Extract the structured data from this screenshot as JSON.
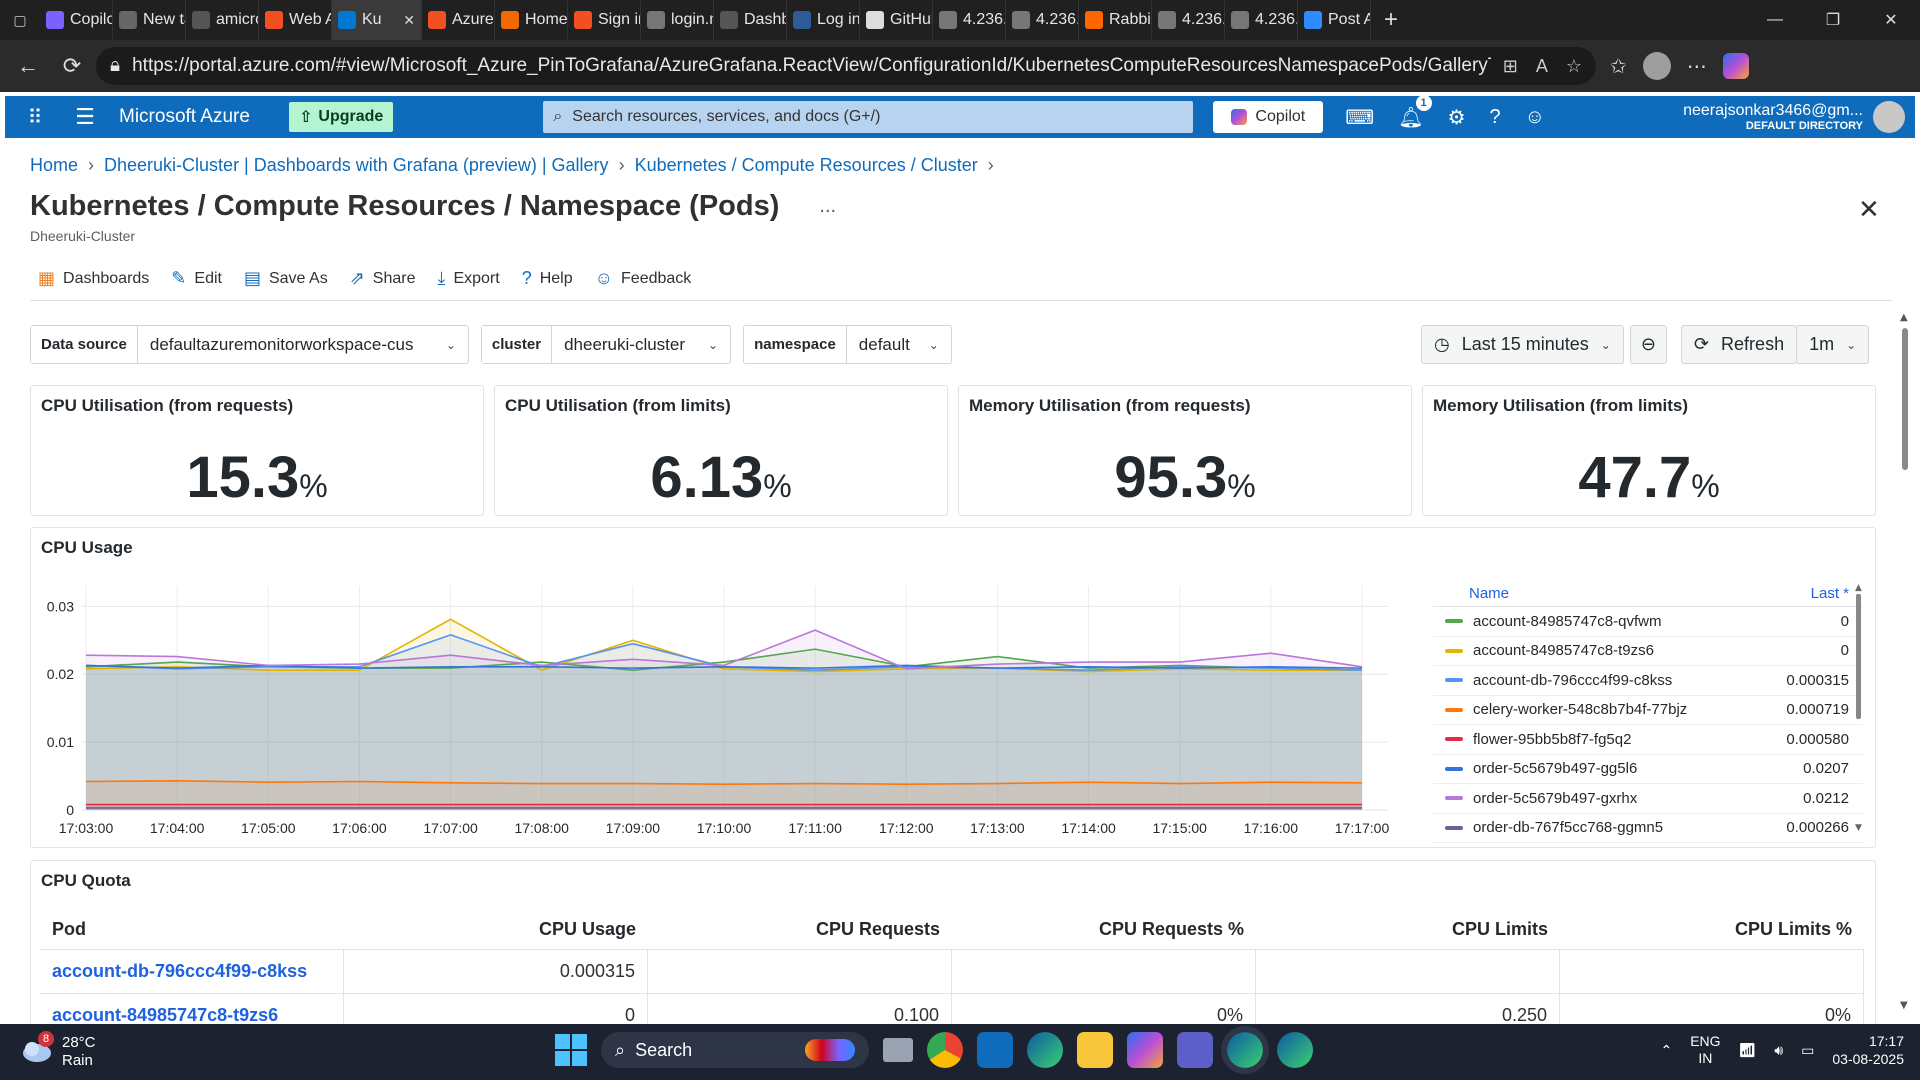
{
  "browser": {
    "tabs": [
      {
        "label": "Copilo",
        "fav": "#7b61ff"
      },
      {
        "label": "New ta",
        "fav": "#666"
      },
      {
        "label": "amicro",
        "fav": "#555"
      },
      {
        "label": "Web A",
        "fav": "#f25022"
      },
      {
        "label": "Ku",
        "fav": "#0078d4",
        "active": true
      },
      {
        "label": "Azure",
        "fav": "#f25022"
      },
      {
        "label": "Home",
        "fav": "#f46800"
      },
      {
        "label": "Sign in",
        "fav": "#f25022"
      },
      {
        "label": "login.m",
        "fav": "#777"
      },
      {
        "label": "Dashbo",
        "fav": "#555"
      },
      {
        "label": "Log in",
        "fav": "#2f5b99"
      },
      {
        "label": "GitHub",
        "fav": "#ddd"
      },
      {
        "label": "4.236.1",
        "fav": "#777"
      },
      {
        "label": "4.236.1",
        "fav": "#777"
      },
      {
        "label": "Rabbit",
        "fav": "#ff6600"
      },
      {
        "label": "4.236.1",
        "fav": "#777"
      },
      {
        "label": "4.236.1",
        "fav": "#777"
      },
      {
        "label": "Post A",
        "fav": "#2d8cff"
      }
    ],
    "url": "https://portal.azure.com/#view/Microsoft_Azure_PinToGrafana/AzureGrafana.ReactView/ConfigurationId/KubernetesComputeResourcesNamespacePods/GalleryType/microsoft.ContainerSe..."
  },
  "azure": {
    "brand": "Microsoft Azure",
    "upgrade": "Upgrade",
    "search_placeholder": "Search resources, services, and docs (G+/)",
    "copilot": "Copilot",
    "notif_count": "1",
    "user_email": "neerajsonkar3466@gm...",
    "user_dir": "DEFAULT DIRECTORY"
  },
  "breadcrumb": [
    "Home",
    "Dheeruki-Cluster | Dashboards with Grafana (preview) | Gallery",
    "Kubernetes / Compute Resources / Cluster"
  ],
  "page": {
    "title": "Kubernetes / Compute Resources / Namespace (Pods)",
    "subtitle": "Dheeruki-Cluster",
    "more": "...",
    "close": "✕"
  },
  "toolbar": {
    "dashboards": "Dashboards",
    "edit": "Edit",
    "save_as": "Save As",
    "share": "Share",
    "export": "Export",
    "help": "Help",
    "feedback": "Feedback"
  },
  "variables": {
    "datasource_label": "Data source",
    "datasource_value": "defaultazuremonitorworkspace-cus",
    "cluster_label": "cluster",
    "cluster_value": "dheeruki-cluster",
    "namespace_label": "namespace",
    "namespace_value": "default"
  },
  "time": {
    "range": "Last 15 minutes",
    "refresh": "Refresh",
    "interval": "1m"
  },
  "stats": [
    {
      "title": "CPU Utilisation (from requests)",
      "value": "15.3",
      "unit": "%"
    },
    {
      "title": "CPU Utilisation (from limits)",
      "value": "6.13",
      "unit": "%"
    },
    {
      "title": "Memory Utilisation (from requests)",
      "value": "95.3",
      "unit": "%"
    },
    {
      "title": "Memory Utilisation (from limits)",
      "value": "47.7",
      "unit": "%"
    }
  ],
  "cpu_usage": {
    "title": "CPU Usage",
    "legend_name": "Name",
    "legend_last": "Last *"
  },
  "chart_data": {
    "type": "area",
    "title": "CPU Usage",
    "x": [
      "17:03:00",
      "17:04:00",
      "17:05:00",
      "17:06:00",
      "17:07:00",
      "17:08:00",
      "17:09:00",
      "17:10:00",
      "17:11:00",
      "17:12:00",
      "17:13:00",
      "17:14:00",
      "17:15:00",
      "17:16:00",
      "17:17:00"
    ],
    "ylim": [
      0,
      0.033
    ],
    "yticks": [
      0,
      0.01,
      0.02,
      0.03
    ],
    "yticklabels": [
      "0",
      "0.01",
      "0.02",
      "0.03"
    ],
    "grid": true,
    "legend_position": "right",
    "series": [
      {
        "name": "account-84985747c8-qvfwm",
        "color": "#56a64b",
        "last": "0",
        "values": [
          0.0211,
          0.0218,
          0.0211,
          0.0209,
          0.0209,
          0.0218,
          0.0206,
          0.0218,
          0.0237,
          0.0211,
          0.0226,
          0.0209,
          0.0213,
          0.0209,
          0.0206
        ]
      },
      {
        "name": "account-84985747c8-t9zs6",
        "color": "#e0b400",
        "last": "0",
        "values": [
          0.0208,
          0.0211,
          0.0206,
          0.0206,
          0.0281,
          0.0206,
          0.025,
          0.0208,
          0.0204,
          0.0208,
          0.0209,
          0.0204,
          0.0208,
          0.0206,
          0.0206
        ]
      },
      {
        "name": "account-db-796ccc4f99-c8kss",
        "color": "#5794f2",
        "last": "0.000315",
        "values": [
          0.0213,
          0.0208,
          0.0211,
          0.0211,
          0.0258,
          0.0211,
          0.0245,
          0.0211,
          0.0206,
          0.0211,
          0.0209,
          0.0206,
          0.0211,
          0.0209,
          0.0206
        ]
      },
      {
        "name": "celery-worker-548c8b7b4f-77bjz",
        "color": "#ff780a",
        "last": "0.000719",
        "values": [
          0.0042,
          0.0043,
          0.0041,
          0.0042,
          0.004,
          0.0039,
          0.0039,
          0.0038,
          0.0039,
          0.0038,
          0.0039,
          0.0041,
          0.0039,
          0.0041,
          0.004
        ]
      },
      {
        "name": "flower-95bb5b8f7-fg5q2",
        "color": "#e02f44",
        "last": "0.000580",
        "values": [
          0.0008,
          0.0008,
          0.0008,
          0.0008,
          0.0008,
          0.0008,
          0.0008,
          0.0008,
          0.0008,
          0.0008,
          0.0008,
          0.0008,
          0.0008,
          0.0008,
          0.0008
        ]
      },
      {
        "name": "order-5c5679b497-gg5l6",
        "color": "#3274d9",
        "last": "0.0207",
        "values": [
          0.0213,
          0.0209,
          0.0213,
          0.0209,
          0.0211,
          0.0211,
          0.0209,
          0.0211,
          0.0209,
          0.0213,
          0.0209,
          0.0211,
          0.0209,
          0.0211,
          0.0209
        ]
      },
      {
        "name": "order-5c5679b497-gxrhx",
        "color": "#b877d9",
        "last": "0.0212",
        "values": [
          0.0228,
          0.0226,
          0.0213,
          0.0215,
          0.0228,
          0.0213,
          0.0222,
          0.0213,
          0.0265,
          0.0208,
          0.0215,
          0.0218,
          0.0218,
          0.0231,
          0.0211
        ]
      },
      {
        "name": "order-db-767f5cc768-ggmn5",
        "color": "#705da0",
        "last": "0.000266",
        "values": [
          0.0003,
          0.0003,
          0.0003,
          0.0003,
          0.0003,
          0.0003,
          0.0003,
          0.0003,
          0.0003,
          0.0003,
          0.0003,
          0.0003,
          0.0003,
          0.0003,
          0.0003
        ]
      }
    ]
  },
  "cpu_quota": {
    "title": "CPU Quota",
    "columns": [
      "Pod",
      "CPU Usage",
      "CPU Requests",
      "CPU Requests %",
      "CPU Limits",
      "CPU Limits %"
    ],
    "rows": [
      [
        "account-db-796ccc4f99-c8kss",
        "0.000315",
        "",
        "",
        "",
        ""
      ],
      [
        "account-84985747c8-t9zs6",
        "0",
        "0.100",
        "0%",
        "0.250",
        "0%"
      ]
    ]
  },
  "taskbar": {
    "temp": "28°C",
    "weather": "Rain",
    "weather_badge": "8",
    "search": "Search",
    "lang1": "ENG",
    "lang2": "IN",
    "time": "17:17",
    "date": "03-08-2025"
  }
}
